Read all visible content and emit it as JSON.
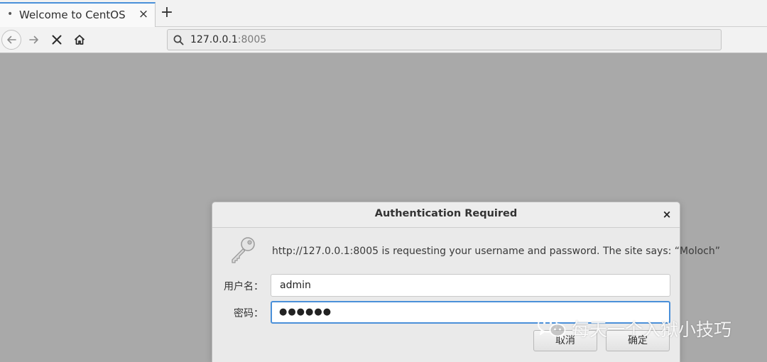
{
  "browser": {
    "tab": {
      "indicator": "•",
      "title": "Welcome to CentOS",
      "close_glyph": "×",
      "close_icon": "close-icon"
    },
    "new_tab_glyph": "+",
    "nav": {
      "back_icon": "arrow-left-icon",
      "forward_icon": "arrow-right-icon",
      "stop_icon": "stop-icon",
      "home_icon": "home-icon"
    },
    "address": {
      "search_icon": "search-icon",
      "host": "127.0.0.1",
      "port": ":8005"
    }
  },
  "dialog": {
    "title": "Authentication Required",
    "close_glyph": "×",
    "key_icon": "key-icon",
    "message": "http://127.0.0.1:8005 is requesting your username and password. The site says: “Moloch”",
    "username_label": "用户名：",
    "username_value": "admin",
    "password_label": "密码：",
    "password_mask": "●●●●●●",
    "cancel_label": "取消",
    "ok_label": "确定"
  },
  "watermark": {
    "icon": "wechat-icon",
    "text": "每天一个入狱小技巧"
  },
  "colors": {
    "page_background": "#a9a9a9",
    "tab_accent": "#4a90d9",
    "focus_border": "#4a90d9"
  }
}
